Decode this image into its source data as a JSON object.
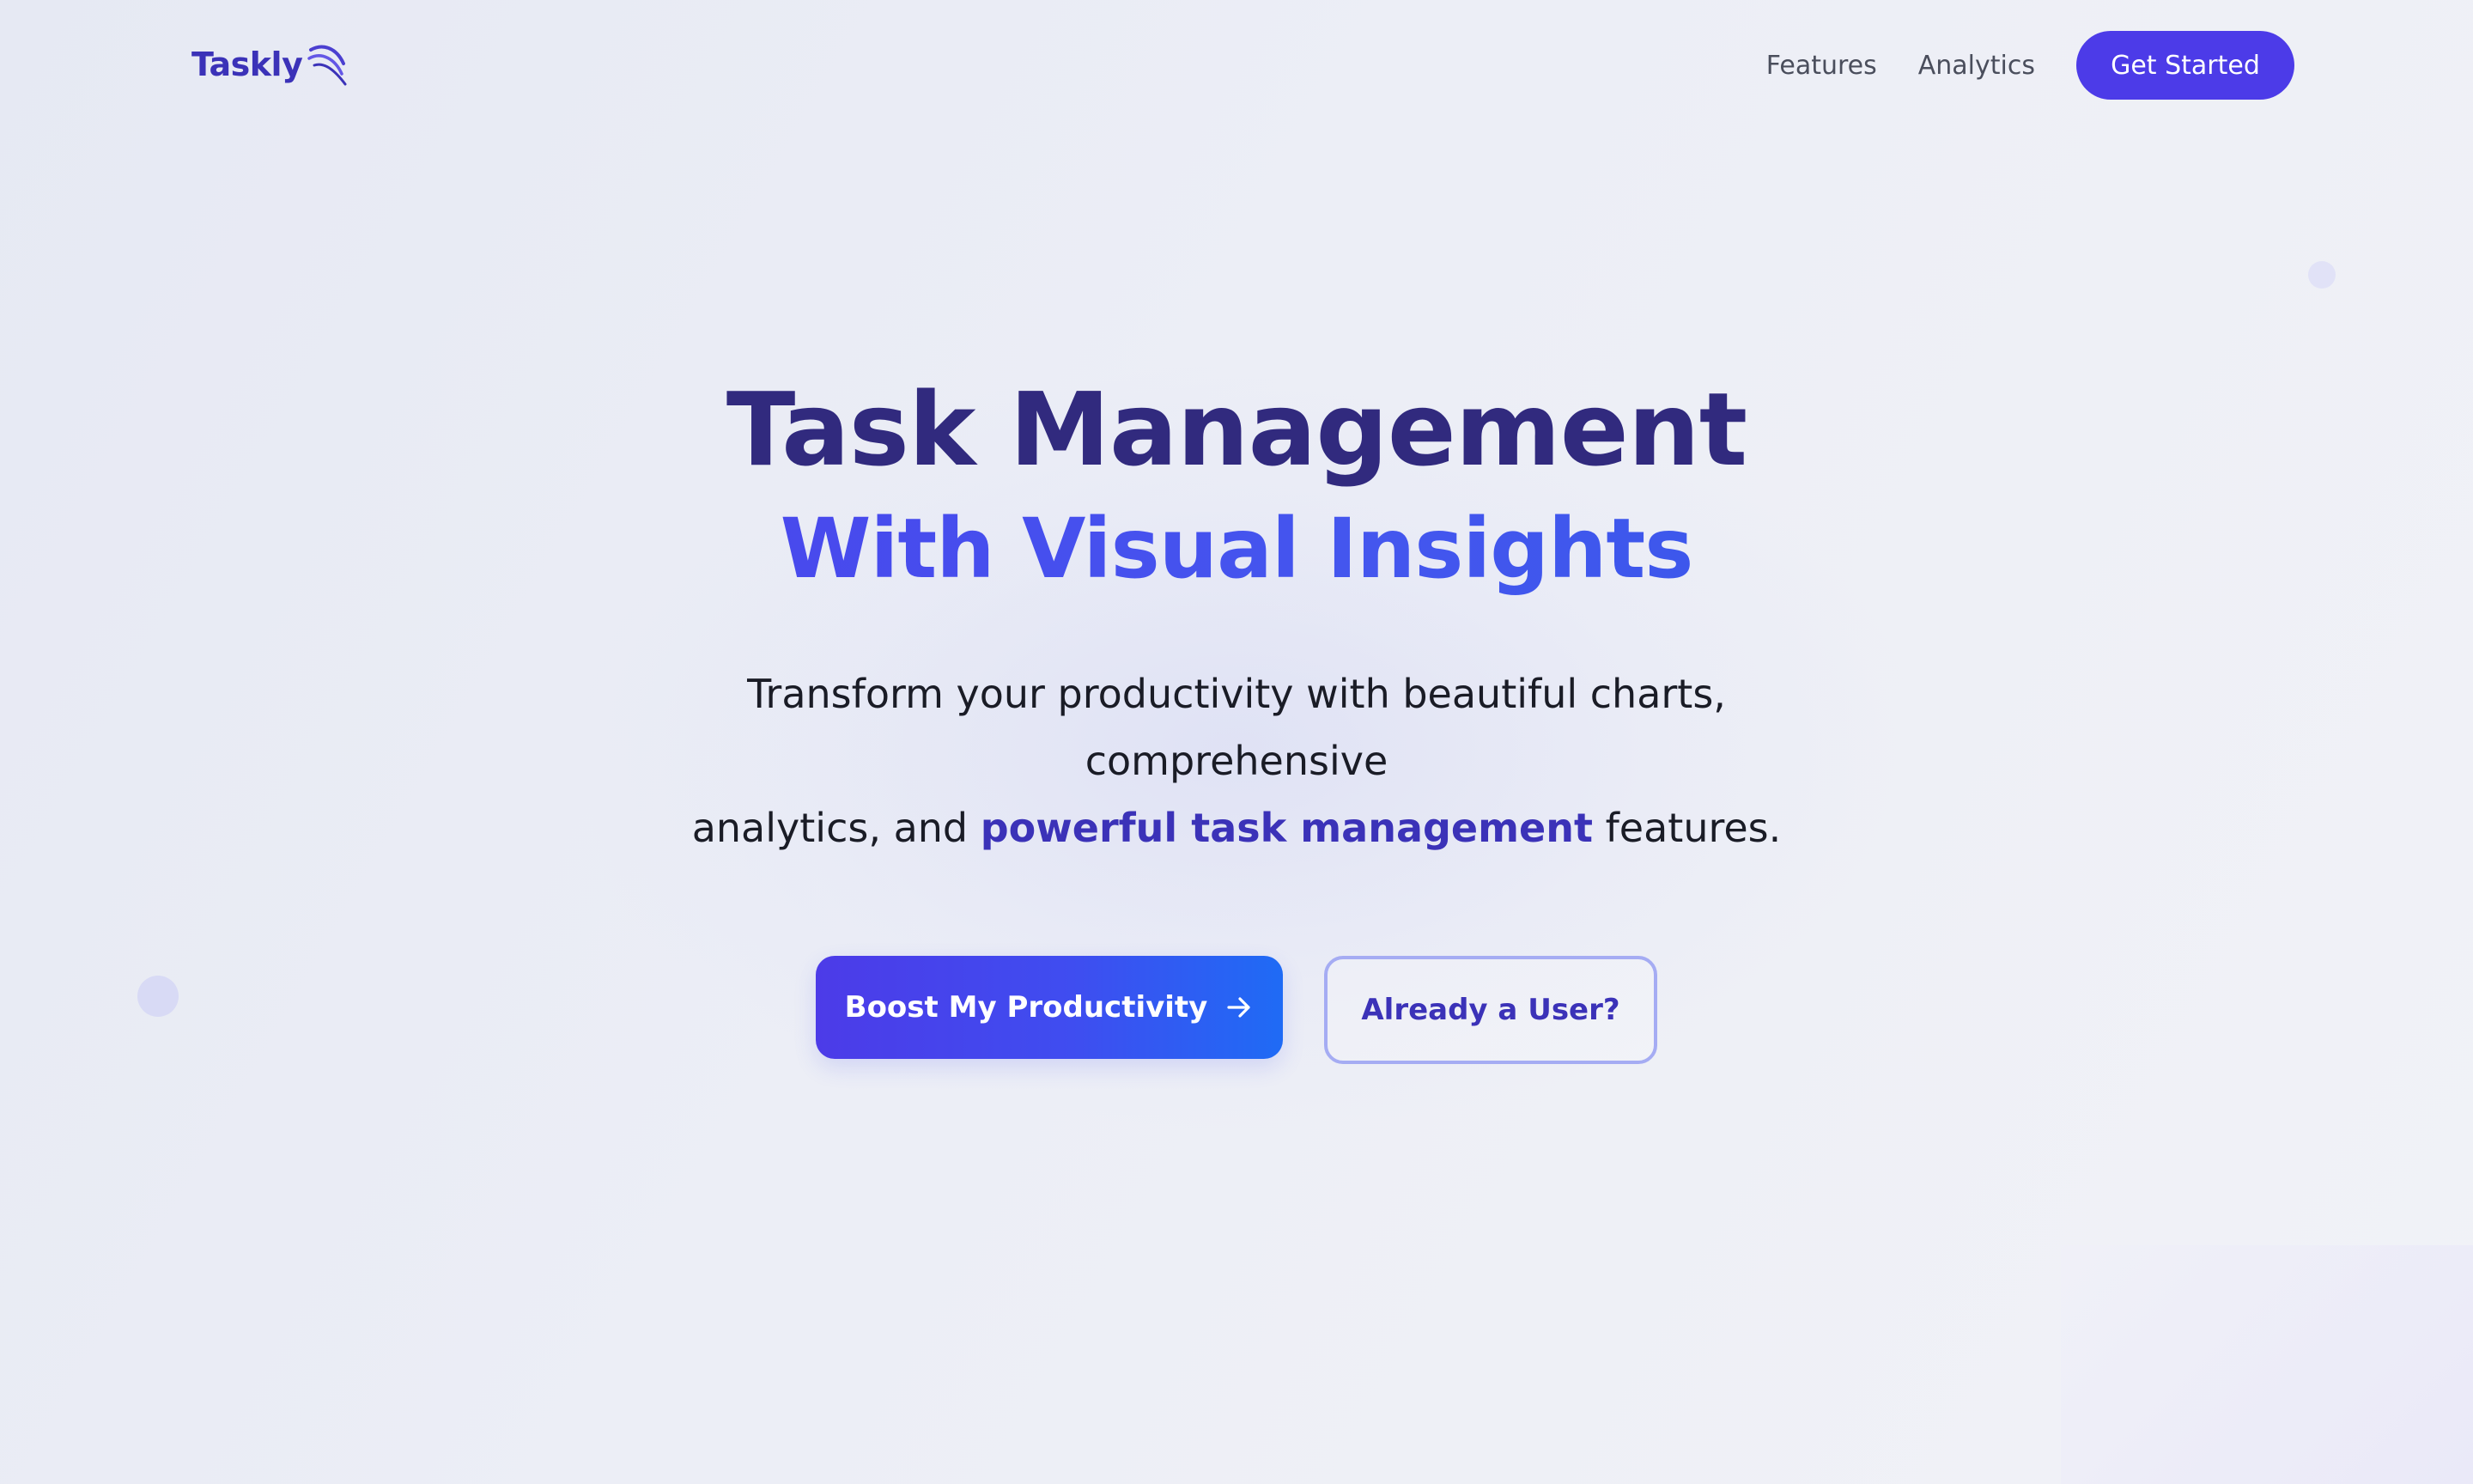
{
  "nav": {
    "brand": "Taskly",
    "brand_icon": "swoosh-icon",
    "links": [
      {
        "label": "Features"
      },
      {
        "label": "Analytics"
      }
    ],
    "cta_label": "Get Started"
  },
  "hero": {
    "title": "Task Management",
    "subtitle": "With Visual Insights",
    "desc_line1": "Transform your productivity with beautiful charts, comprehensive",
    "desc_line2_before": "analytics, and",
    "desc_highlight": "powerful task management",
    "desc_line2_after": "features.",
    "primary_label": "Boost My Productivity",
    "primary_icon": "arrow-right-icon",
    "secondary_label": "Already a User?"
  },
  "colors": {
    "brand_primary": "#4c3be8",
    "brand_dark": "#312a7e",
    "accent_blue": "#1f6bf5",
    "text_body": "#1a1c26",
    "nav_text": "#4a4e5c",
    "secondary_border": "#a5acf3"
  }
}
